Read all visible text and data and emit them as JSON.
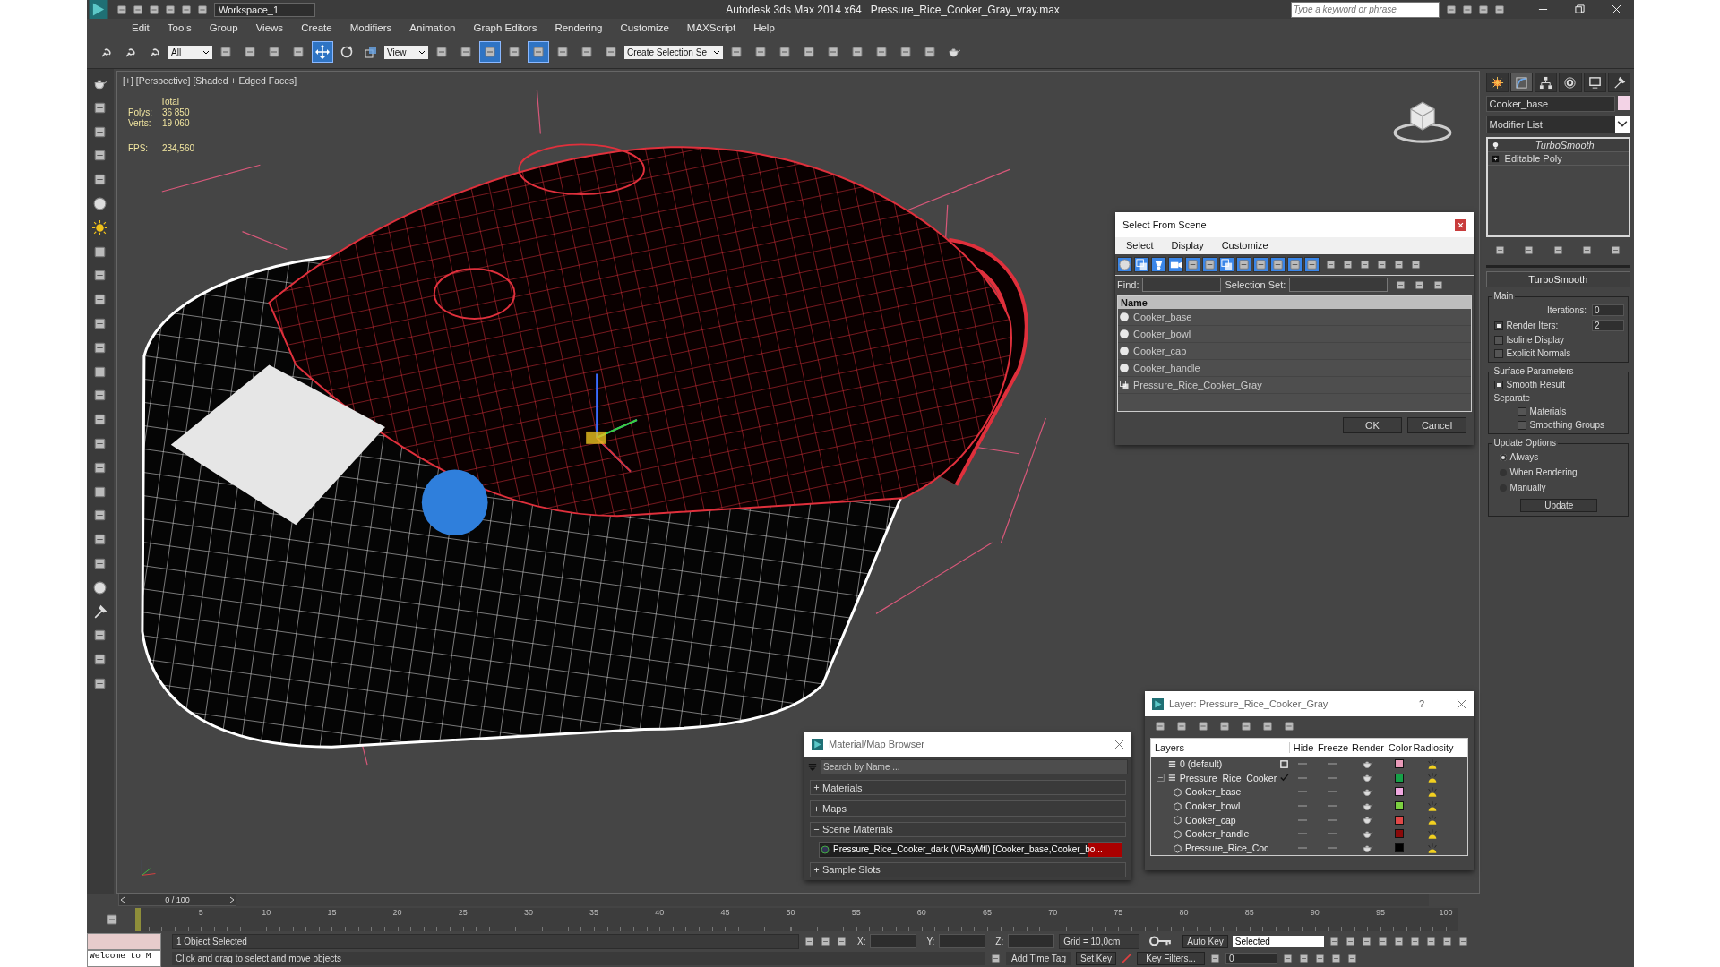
{
  "title_bar": {
    "workspace": "Workspace_1",
    "app": "Autodesk 3ds Max  2014 x64",
    "file": "Pressure_Rice_Cooker_Gray_vray.max",
    "search_placeholder": "Type a keyword or phrase"
  },
  "menu": [
    "Edit",
    "Tools",
    "Group",
    "Views",
    "Create",
    "Modifiers",
    "Animation",
    "Graph Editors",
    "Rendering",
    "Customize",
    "MAXScript",
    "Help"
  ],
  "toolbar": {
    "items": [
      {
        "kind": "button",
        "active": false
      },
      {
        "kind": "button",
        "active": false
      },
      {
        "kind": "button",
        "active": false
      },
      {
        "kind": "dropdown",
        "value": "All"
      },
      {
        "kind": "button",
        "active": false
      },
      {
        "kind": "button",
        "active": false
      },
      {
        "kind": "button",
        "active": false
      },
      {
        "kind": "button",
        "active": false
      },
      {
        "kind": "button",
        "active": true
      },
      {
        "kind": "button",
        "active": false
      },
      {
        "kind": "button",
        "active": false
      },
      {
        "kind": "dropdown",
        "value": "View"
      },
      {
        "kind": "button",
        "active": false
      },
      {
        "kind": "button",
        "active": false
      },
      {
        "kind": "button",
        "active": true
      },
      {
        "kind": "button",
        "active": false
      },
      {
        "kind": "button",
        "active": true
      },
      {
        "kind": "button",
        "active": false
      },
      {
        "kind": "button",
        "active": false
      },
      {
        "kind": "button",
        "active": false
      },
      {
        "kind": "dropdown",
        "value": "Create Selection Se"
      },
      {
        "kind": "button",
        "active": false
      },
      {
        "kind": "button",
        "active": false
      },
      {
        "kind": "button",
        "active": false
      },
      {
        "kind": "button",
        "active": false
      },
      {
        "kind": "button",
        "active": false
      },
      {
        "kind": "button",
        "active": false
      },
      {
        "kind": "button",
        "active": false
      },
      {
        "kind": "button",
        "active": false
      },
      {
        "kind": "button",
        "active": false
      },
      {
        "kind": "button",
        "active": false
      }
    ]
  },
  "viewport": {
    "label": "[+] [Perspective] [Shaded + Edged Faces]",
    "stats_heading": "Total",
    "stats": [
      {
        "label": "Polys:",
        "value": "36 850"
      },
      {
        "label": "Verts:",
        "value": "19 060"
      }
    ],
    "fps": {
      "label": "FPS:",
      "value": "234,560"
    }
  },
  "command_panel": {
    "tabs": [
      {
        "selected": false
      },
      {
        "selected": true
      },
      {
        "selected": false
      },
      {
        "selected": false
      },
      {
        "selected": false
      },
      {
        "selected": false
      }
    ],
    "object_name": "Cooker_base",
    "modifier_list": "Modifier List",
    "stack": [
      {
        "name": "TurboSmooth",
        "kind": "modifier"
      },
      {
        "name": "Editable Poly",
        "kind": "base"
      }
    ],
    "rollout": "TurboSmooth",
    "main": {
      "title": "Main",
      "iterations_label": "Iterations:",
      "iterations": "0",
      "render_iters_label": "Render Iters:",
      "render_iters_checked": true,
      "render_iters": "2",
      "options": [
        {
          "label": "Isoline Display",
          "checked": false
        },
        {
          "label": "Explicit Normals",
          "checked": false
        }
      ]
    },
    "surface": {
      "title": "Surface Parameters",
      "smooth_result": {
        "label": "Smooth Result",
        "checked": true
      },
      "separate": "Separate",
      "options": [
        {
          "label": "Materials",
          "checked": false
        },
        {
          "label": "Smoothing Groups",
          "checked": false
        }
      ]
    },
    "update": {
      "title": "Update Options",
      "radios": [
        {
          "label": "Always",
          "selected": true
        },
        {
          "label": "When Rendering",
          "selected": false
        },
        {
          "label": "Manually",
          "selected": false
        }
      ],
      "button": "Update"
    }
  },
  "select_dialog": {
    "title": "Select From Scene",
    "menu": [
      "Select",
      "Display",
      "Customize"
    ],
    "filters": [
      {
        "on": true
      },
      {
        "on": true
      },
      {
        "on": true
      },
      {
        "on": true
      },
      {
        "on": true
      },
      {
        "on": true
      },
      {
        "on": true
      },
      {
        "on": true
      },
      {
        "on": true
      },
      {
        "on": true
      },
      {
        "on": true
      },
      {
        "on": true
      }
    ],
    "find_label": "Find:",
    "selection_set_label": "Selection Set:",
    "column": "Name",
    "items": [
      {
        "name": "Cooker_base",
        "kind": "geometry"
      },
      {
        "name": "Cooker_bowl",
        "kind": "geometry"
      },
      {
        "name": "Cooker_cap",
        "kind": "geometry"
      },
      {
        "name": "Cooker_handle",
        "kind": "geometry"
      },
      {
        "name": "Pressure_Rice_Cooker_Gray",
        "kind": "group"
      }
    ],
    "buttons": [
      "OK",
      "Cancel"
    ]
  },
  "material_browser": {
    "title": "Material/Map Browser",
    "search_placeholder": "Search by Name ...",
    "groups": [
      {
        "label": "Materials",
        "expanded": false
      },
      {
        "label": "Maps",
        "expanded": false
      },
      {
        "label": "Scene Materials",
        "expanded": true,
        "items": [
          "Pressure_Rice_Cooker_dark (VRayMtl) [Cooker_base,Cooker_bo..."
        ]
      },
      {
        "label": "Sample Slots",
        "expanded": false
      }
    ]
  },
  "layer_dialog": {
    "title": "Layer: Pressure_Rice_Cooker_Gray",
    "help": "?",
    "columns": [
      "Layers",
      "Hide",
      "Freeze",
      "Render",
      "Color",
      "Radiosity"
    ],
    "layers": [
      {
        "name": "0 (default)",
        "current": false,
        "color": "#e89ab8"
      },
      {
        "name": "Pressure_Rice_Cooker",
        "current": true,
        "expanded": true,
        "color": "#17a048",
        "children": [
          {
            "name": "Cooker_base",
            "color": "#f0a8e0"
          },
          {
            "name": "Cooker_bowl",
            "color": "#7cd040"
          },
          {
            "name": "Cooker_cap",
            "color": "#e04848"
          },
          {
            "name": "Cooker_handle",
            "color": "#8a0a0a"
          },
          {
            "name": "Pressure_Rice_Coc",
            "color": "#000000"
          }
        ]
      }
    ]
  },
  "timeline": {
    "position": "0 / 100",
    "level": 0,
    "ticks": [
      "5",
      "10",
      "15",
      "20",
      "25",
      "30",
      "35",
      "40",
      "45",
      "50",
      "55",
      "60",
      "65",
      "70",
      "75",
      "80",
      "85",
      "90",
      "95",
      "100"
    ]
  },
  "status_bar": {
    "listener": "Welcome to M",
    "selection": "1 Object Selected",
    "prompt": "Click and drag to select and move objects",
    "x_label": "X:",
    "y_label": "Y:",
    "z_label": "Z:",
    "grid": "Grid = 10,0cm",
    "auto_key": "Auto Key",
    "key_mode": "Selected",
    "set_key": "Set Key",
    "key_filters": "Key Filters...",
    "add_time_tag": "Add Time Tag",
    "frame": "0"
  }
}
